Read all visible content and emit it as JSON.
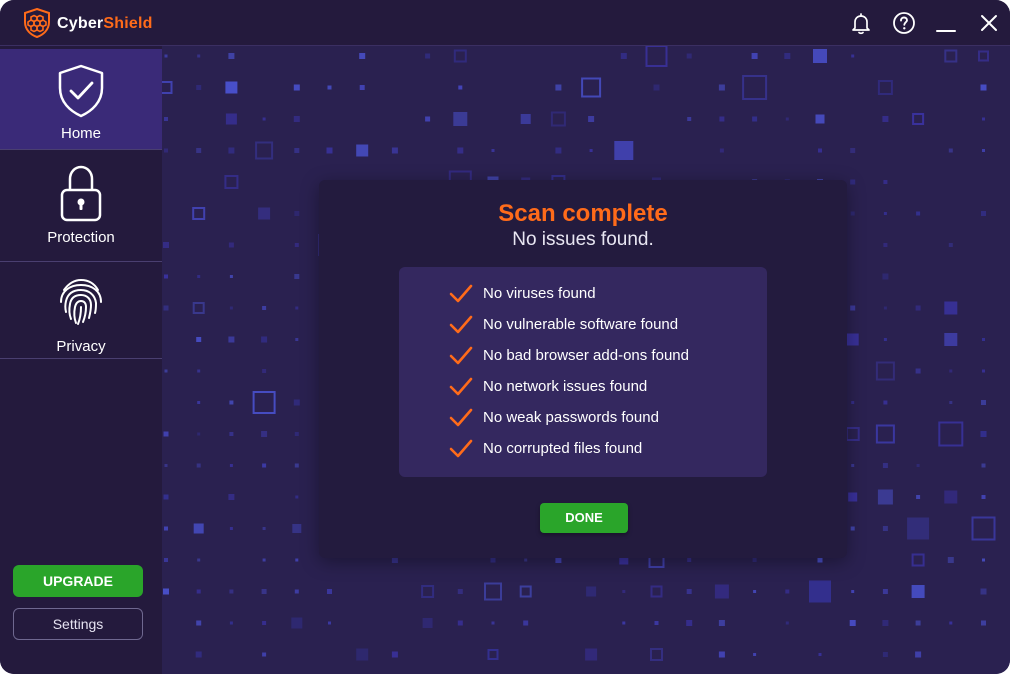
{
  "app": {
    "brand_part1": "Cyber",
    "brand_part2": "Shield",
    "accent_color": "#ff6b1a",
    "success_color": "#2aa52a"
  },
  "titlebar": {
    "icons": [
      "bell-icon",
      "help-icon",
      "minimize-icon",
      "close-icon"
    ]
  },
  "sidebar": {
    "items": [
      {
        "label": "Home",
        "icon": "shield-check-icon",
        "active": true
      },
      {
        "label": "Protection",
        "icon": "lock-icon",
        "active": false
      },
      {
        "label": "Privacy",
        "icon": "fingerprint-icon",
        "active": false
      }
    ],
    "upgrade_label": "UPGRADE",
    "settings_label": "Settings"
  },
  "scan": {
    "title": "Scan complete",
    "subtitle": "No issues found.",
    "results": [
      "No viruses found",
      "No vulnerable software found",
      "No bad browser add-ons found",
      "No network issues found",
      "No weak passwords found",
      "No corrupted files found"
    ],
    "done_label": "DONE"
  }
}
